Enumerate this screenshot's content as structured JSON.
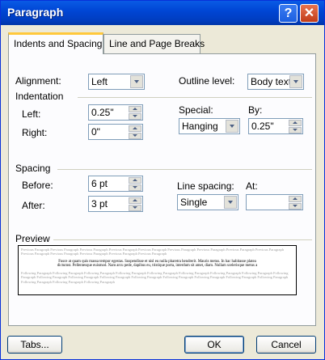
{
  "window": {
    "title": "Paragraph"
  },
  "titlebar": {
    "help_glyph": "?",
    "close_glyph": "✕"
  },
  "tabs": [
    {
      "label": "Indents and Spacing",
      "active": true
    },
    {
      "label": "Line and Page Breaks",
      "active": false
    }
  ],
  "general": {
    "alignment_label": "Alignment:",
    "alignment_value": "Left",
    "outline_label": "Outline level:",
    "outline_value": "Body text"
  },
  "indentation": {
    "section_label": "Indentation",
    "left_label": "Left:",
    "left_value": "0.25\"",
    "right_label": "Right:",
    "right_value": "0\"",
    "special_label": "Special:",
    "special_value": "Hanging",
    "by_label": "By:",
    "by_value": "0.25\""
  },
  "spacing": {
    "section_label": "Spacing",
    "before_label": "Before:",
    "before_value": "6 pt",
    "after_label": "After:",
    "after_value": "3 pt",
    "line_spacing_label": "Line spacing:",
    "line_spacing_value": "Single",
    "at_label": "At:",
    "at_value": ""
  },
  "preview": {
    "section_label": "Preview",
    "previous_text": "Previous Paragraph Previous Paragraph Previous Paragraph Previous Paragraph Previous Paragraph Previous Paragraph Previous Paragraph Previous Paragraph Previous Paragraph Previous Paragraph Previous Paragraph Previous Paragraph Previous Paragraph Previous Paragraph",
    "sample_text": "Fusce at quam quis massa tempor egestas. Suspendisse et nisl eu nulla pharetra hendrerit. Mauris metus. In hac habitasse platea dictumst. Pellentesque euismod. Nam arcu pede, dapibus eu, tristique porta, interdum sit amet, diam. Nullam scelerisque metus a",
    "following_text": "Following Paragraph Following Paragraph Following Paragraph Following Paragraph Following Paragraph Following Paragraph Following Paragraph Following Paragraph Following Paragraph Following Paragraph Following Paragraph Following Paragraph Following Paragraph Following Paragraph Following Paragraph Following Paragraph Following Paragraph Following Paragraph Following Paragraph Following Paragraph"
  },
  "buttons": {
    "tabs_label": "Tabs...",
    "ok_label": "OK",
    "cancel_label": "Cancel"
  }
}
